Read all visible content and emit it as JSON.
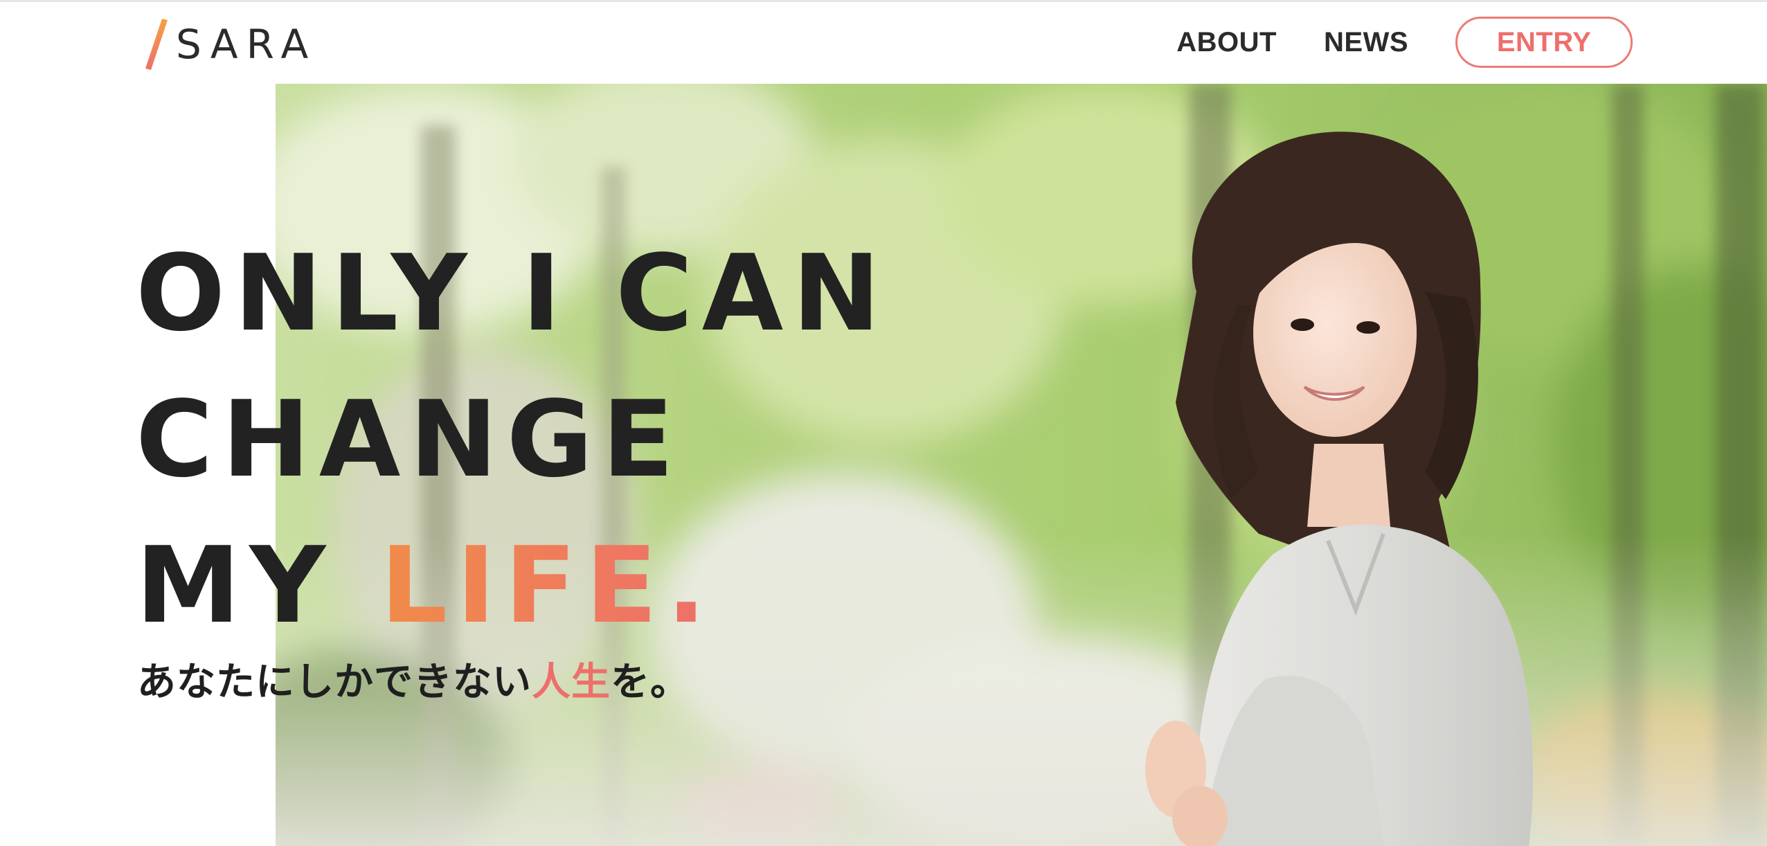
{
  "brand": {
    "name": "SARA",
    "accent_color": "#f08b4a"
  },
  "nav": {
    "items": [
      {
        "label": "ABOUT"
      },
      {
        "label": "NEWS"
      }
    ],
    "entry_label": "ENTRY",
    "entry_color": "#ee6f6a"
  },
  "hero": {
    "headline": {
      "line1": "ONLY I CAN",
      "line2": "CHANGE",
      "line3_prefix": "MY ",
      "line3_accent": "LIFE."
    },
    "subline": {
      "prefix": "あなたにしかできない",
      "accent": "人生",
      "suffix": "を。"
    },
    "photo": {
      "icon": "portrait-photo",
      "background_color": "#b9d68a"
    }
  }
}
